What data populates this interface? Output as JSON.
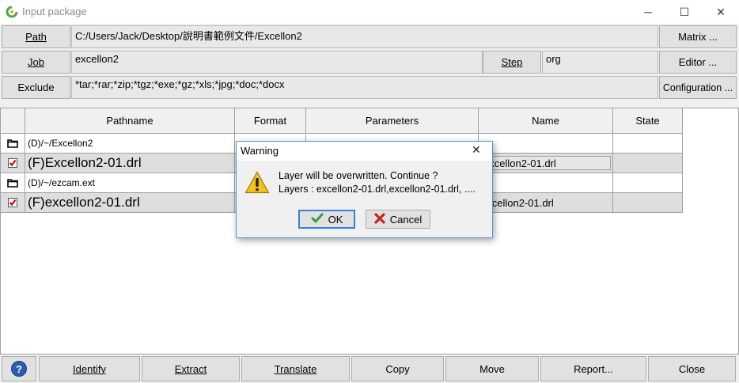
{
  "window": {
    "title": "Input package",
    "minimize_glyph": "─",
    "maximize_glyph": "☐",
    "close_glyph": "✕"
  },
  "form": {
    "path_label": "Path",
    "path_value": "C:/Users/Jack/Desktop/說明書範例文件/Excellon2",
    "job_label": "Job",
    "job_value": "excellon2",
    "step_label": "Step",
    "step_value": "org",
    "exclude_label": "Exclude",
    "exclude_value": "*tar;*rar;*zip;*tgz;*exe;*gz;*xls;*jpg;*doc;*docx",
    "matrix_label": "Matrix ...",
    "editor_label": "Editor ...",
    "configuration_label": "Configuration ..."
  },
  "table": {
    "headers": [
      "Pathname",
      "Format",
      "Parameters",
      "Name",
      "State"
    ],
    "rows": [
      {
        "icon": "folder-icon",
        "pathname": "(D)/~/Excellon2",
        "name": ""
      },
      {
        "icon": "checkbox-icon",
        "pathname": "(F)Excellon2-01.drl",
        "name": "excellon2-01.drl"
      },
      {
        "icon": "folder-icon",
        "pathname": "(D)/~/ezcam.ext",
        "name": ""
      },
      {
        "icon": "checkbox-icon",
        "pathname": "(F)excellon2-01.drl",
        "name": "excellon2-01.drl"
      }
    ]
  },
  "dialog": {
    "title": "Warning",
    "message_line1": "Layer will be overwritten. Continue ?",
    "message_line2": "Layers : excellon2-01.drl,excellon2-01.drl, ....",
    "ok_label": "OK",
    "cancel_label": "Cancel"
  },
  "bottom": {
    "help_glyph": "?",
    "identify_label": "Identify",
    "extract_label": "Extract",
    "translate_label": "Translate",
    "copy_label": "Copy",
    "move_label": "Move",
    "report_label": "Report...",
    "close_label": "Close"
  },
  "colors": {
    "dialog_border": "#5b8fcf",
    "check_red": "#cc0000",
    "ok_green": "#3a9a3a",
    "cancel_red": "#cc2222",
    "help_blue": "#2a5db0"
  }
}
